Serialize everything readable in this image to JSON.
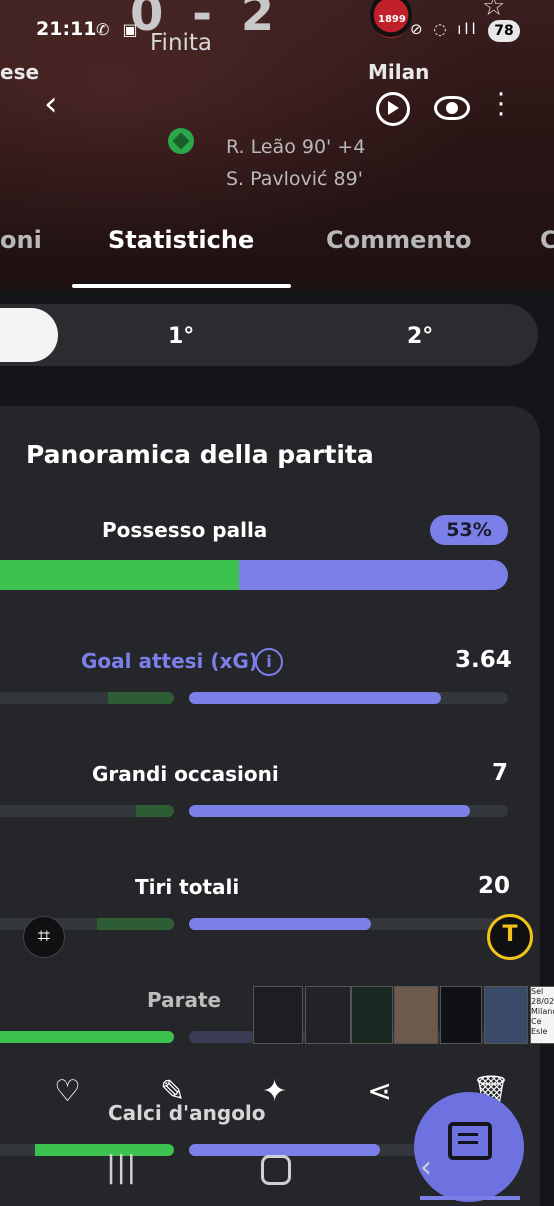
{
  "status_bar": {
    "time": "21:11",
    "battery": "78",
    "signal_icons": "✆ ▣",
    "right_icons": "⊘ ◌ ıll"
  },
  "match": {
    "score": "0 - 2",
    "status": "Finita",
    "home_team": "ese",
    "away_team": "Milan",
    "crest_year": "1899",
    "scorers": [
      "R. Leão 90' +4",
      "S. Pavlović 89'"
    ]
  },
  "tabs": [
    {
      "label": "oni"
    },
    {
      "label": "Statistiche",
      "active": true
    },
    {
      "label": "Commento"
    },
    {
      "label": "C"
    }
  ],
  "periods": [
    "1°",
    "2°"
  ],
  "overview": {
    "title": "Panoramica della partita",
    "possession": {
      "label": "Possesso palla",
      "away_value": "53%",
      "home_fraction": 0.47,
      "away_fraction": 0.53
    },
    "stats": [
      {
        "label": "Goal attesi (xG)",
        "info_icon": "info-icon",
        "away_value": "3.64",
        "home_fraction": 0.38,
        "away_fraction": 0.79
      },
      {
        "label": "Grandi occasioni",
        "away_value": "7",
        "home_fraction": 0.22,
        "away_fraction": 0.88
      },
      {
        "label": "Tiri totali",
        "away_value": "20",
        "home_fraction": 0.44,
        "away_fraction": 0.57
      },
      {
        "label": "Parate",
        "away_value": "",
        "home_fraction": 1.0,
        "away_fraction": 0.2
      },
      {
        "label": "Calci d'angolo",
        "away_value": "",
        "home_fraction": 0.8,
        "away_fraction": 0.6
      }
    ]
  },
  "overlay_toolbar": {
    "crop_icon": "crop-icon",
    "text_icon": "text-recognition-icon",
    "thumb_caption": "Sel 28/02 Milano Ce Esle",
    "actions": [
      "heart-icon",
      "edit-icon",
      "sparkle-icon",
      "share-icon",
      "delete-icon"
    ]
  },
  "colors": {
    "accent": "#7b7fe8",
    "home": "#3ec24f",
    "home_dim": "#2d5d34",
    "card": "#24262a"
  }
}
